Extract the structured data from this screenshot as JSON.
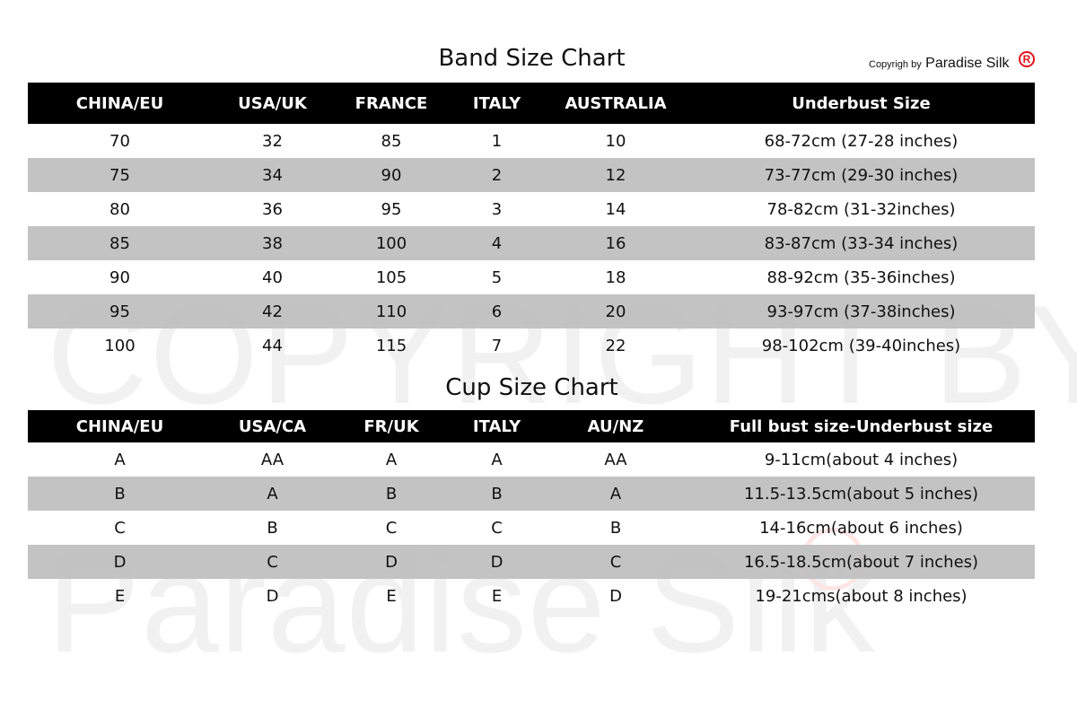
{
  "watermark": {
    "line1": "COPYRIGHT BY",
    "line2": "Paradise Silk",
    "registered_mark": "R"
  },
  "copyright_notice": {
    "prefix": "Copyrigh by",
    "brand": "Paradise Silk",
    "registered_mark": "R",
    "mark_color": "#e0141b"
  },
  "band_chart": {
    "title": "Band Size Chart",
    "headers": [
      "CHINA/EU",
      "USA/UK",
      "FRANCE",
      "ITALY",
      "AUSTRALIA",
      "Underbust Size"
    ],
    "rows": [
      [
        "70",
        "32",
        "85",
        "1",
        "10",
        "68-72cm  (27-28 inches)"
      ],
      [
        "75",
        "34",
        "90",
        "2",
        "12",
        "73-77cm (29-30 inches)"
      ],
      [
        "80",
        "36",
        "95",
        "3",
        "14",
        "78-82cm (31-32inches)"
      ],
      [
        "85",
        "38",
        "100",
        "4",
        "16",
        "83-87cm (33-34 inches)"
      ],
      [
        "90",
        "40",
        "105",
        "5",
        "18",
        "88-92cm (35-36inches)"
      ],
      [
        "95",
        "42",
        "110",
        "6",
        "20",
        "93-97cm (37-38inches)"
      ],
      [
        "100",
        "44",
        "115",
        "7",
        "22",
        "98-102cm (39-40inches)"
      ]
    ]
  },
  "cup_chart": {
    "title": "Cup Size Chart",
    "headers": [
      "CHINA/EU",
      "USA/CA",
      "FR/UK",
      "ITALY",
      "AU/NZ",
      "Full bust size-Underbust size"
    ],
    "rows": [
      [
        "A",
        "AA",
        "A",
        "A",
        "AA",
        "9-11cm(about 4 inches)"
      ],
      [
        "B",
        "A",
        "B",
        "B",
        "A",
        "11.5-13.5cm(about 5 inches)"
      ],
      [
        "C",
        "B",
        "C",
        "C",
        "B",
        "14-16cm(about 6 inches)"
      ],
      [
        "D",
        "C",
        "D",
        "D",
        "C",
        "16.5-18.5cm(about 7 inches)"
      ],
      [
        "E",
        "D",
        "E",
        "E",
        "D",
        "19-21cms(about 8 inches)"
      ]
    ]
  },
  "colors": {
    "header_bg": "#000000",
    "header_text": "#ffffff",
    "stripe_bg": "#bebebe"
  }
}
